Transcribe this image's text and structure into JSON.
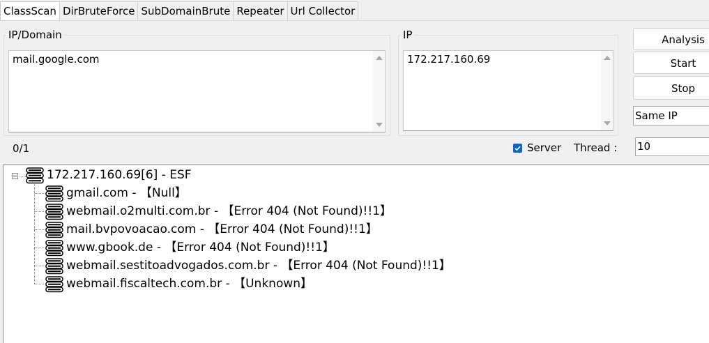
{
  "tabs": [
    "ClassScan",
    "DirBruteForce",
    "SubDomainBrute",
    "Repeater",
    "Url Collector"
  ],
  "ip_domain_group": {
    "title": "IP/Domain",
    "value": "mail.google.com"
  },
  "ip_group": {
    "title": "IP",
    "value": "172.217.160.69"
  },
  "buttons": {
    "analysis": "Analysis",
    "start": "Start",
    "stop": "Stop"
  },
  "mode_select": {
    "value": "Same IP"
  },
  "progress": "0/1",
  "server_checkbox": {
    "label": "Server",
    "checked": true
  },
  "thread": {
    "label": "Thread :",
    "value": "10"
  },
  "tree": {
    "root": "172.217.160.69[6] - ESF",
    "children": [
      "gmail.com - 【Null】",
      "webmail.o2multi.com.br - 【Error 404 (Not Found)!!1】",
      "mail.bvpovoacao.com - 【Error 404 (Not Found)!!1】",
      "www.gbook.de - 【Error 404 (Not Found)!!1】",
      "webmail.sestitoadvogados.com.br - 【Error 404 (Not Found)!!1】",
      "webmail.fiscaltech.com.br - 【Unknown】"
    ],
    "icon": "server-icon"
  },
  "colors": {
    "checkbox": "#0a64c6",
    "tree_border": "#828790"
  }
}
